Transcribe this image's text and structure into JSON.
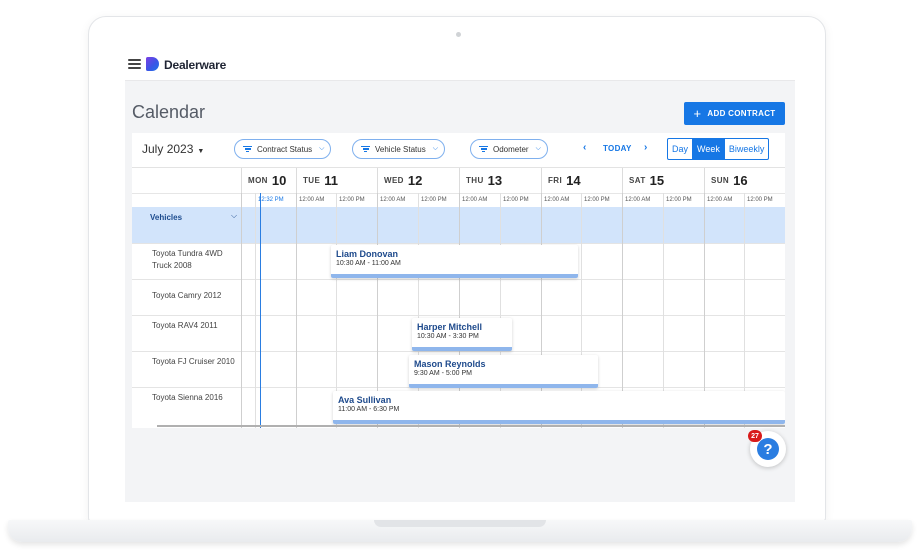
{
  "app": {
    "brand": "Dealerware"
  },
  "page": {
    "title": "Calendar",
    "add_contract_label": "ADD CONTRACT"
  },
  "toolbar": {
    "month": "July",
    "year": "2023",
    "filters": [
      "Contract Status",
      "Vehicle Status",
      "Odometer"
    ],
    "today_label": "TODAY",
    "views": [
      "Day",
      "Week",
      "Biweekly"
    ],
    "active_view": "Week"
  },
  "days": [
    {
      "name": "MON",
      "num": "10"
    },
    {
      "name": "TUE",
      "num": "11"
    },
    {
      "name": "WED",
      "num": "12"
    },
    {
      "name": "THU",
      "num": "13"
    },
    {
      "name": "FRI",
      "num": "14"
    },
    {
      "name": "SAT",
      "num": "15"
    },
    {
      "name": "SUN",
      "num": "16"
    }
  ],
  "time_labels": {
    "am": "12:00 AM",
    "pm": "12:00 PM",
    "now": "12:32 PM"
  },
  "group": {
    "label": "Vehicles"
  },
  "vehicles": [
    "Toyota Tundra 4WD Truck 2008",
    "Toyota Camry 2012",
    "Toyota RAV4 2011",
    "Toyota FJ Cruiser 2010",
    "Toyota Sienna 2016"
  ],
  "events": [
    {
      "name": "Liam Donovan",
      "time": "10:30 AM - 11:00 AM"
    },
    {
      "name": "Harper Mitchell",
      "time": "10:30 AM - 3:30 PM"
    },
    {
      "name": "Mason Reynolds",
      "time": "9:30 AM - 5:00 PM"
    },
    {
      "name": "Ava Sullivan",
      "time": "11:00 AM - 6:30 PM"
    }
  ],
  "help": {
    "badge_count": "27",
    "icon": "question-icon"
  },
  "colors": {
    "accent": "#1677e5",
    "group_bg": "#d2e4fb",
    "event_bar": "#8fb6ec",
    "badge": "#d81b1b"
  }
}
